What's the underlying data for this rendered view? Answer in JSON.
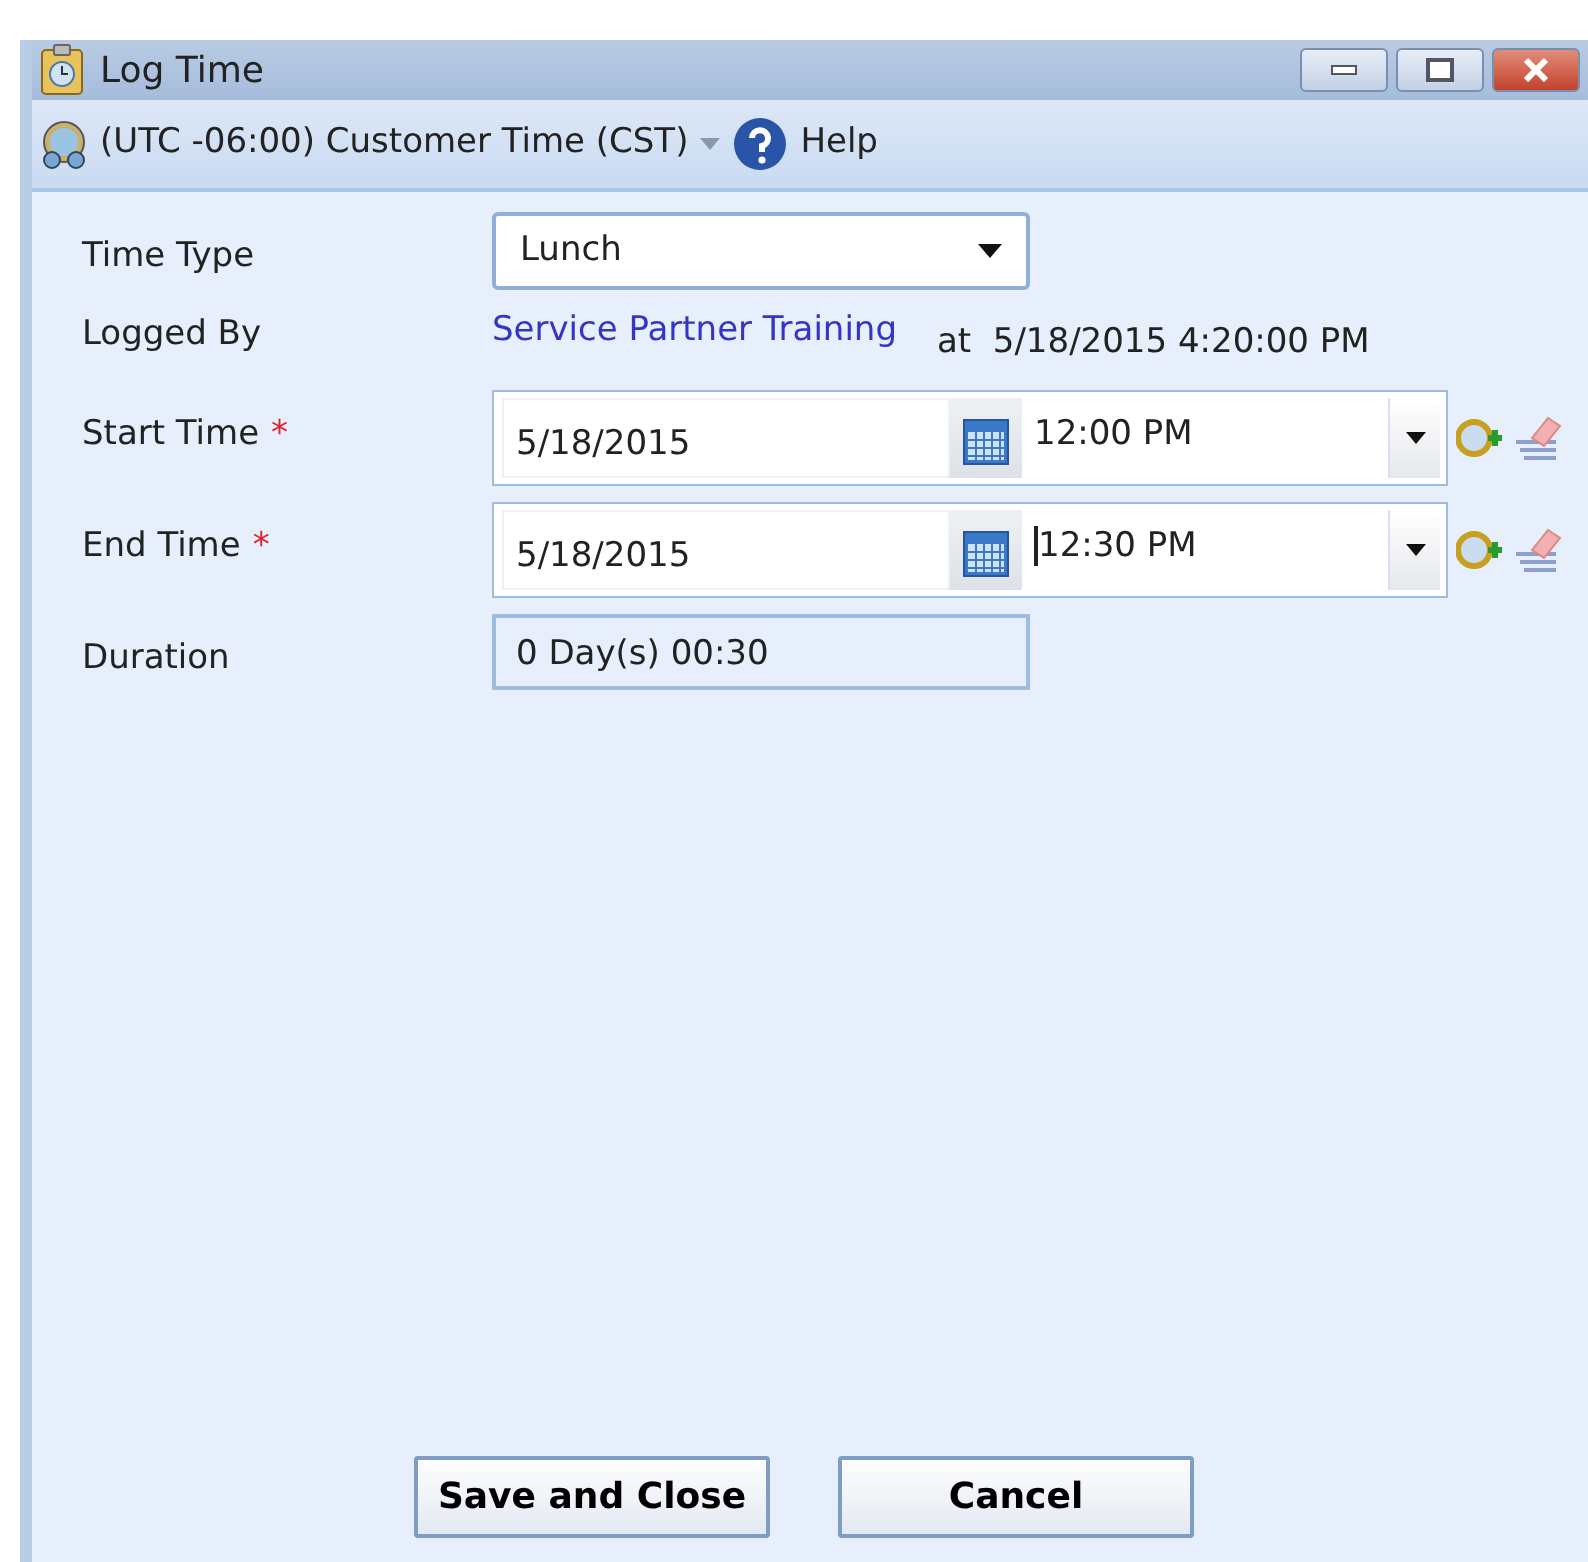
{
  "window": {
    "title": "Log Time"
  },
  "toolbar": {
    "timezone": "(UTC -06:00) Customer Time (CST)",
    "help": "Help"
  },
  "form": {
    "time_type": {
      "label": "Time Type",
      "value": "Lunch"
    },
    "logged_by": {
      "label": "Logged By",
      "user": "Service Partner Training",
      "at": "at  5/18/2015 4:20:00 PM"
    },
    "times": [
      {
        "label": "Start Time",
        "required": true,
        "required_mark": "*",
        "date": "5/18/2015",
        "time": "12:00 PM",
        "focused": false
      },
      {
        "label": "End Time",
        "required": true,
        "required_mark": "*",
        "date": "5/18/2015",
        "time": "12:30 PM",
        "focused": true
      }
    ],
    "duration": {
      "label": "Duration",
      "value": "0 Day(s) 00:30"
    }
  },
  "buttons": [
    "Save and Close",
    "Cancel"
  ]
}
